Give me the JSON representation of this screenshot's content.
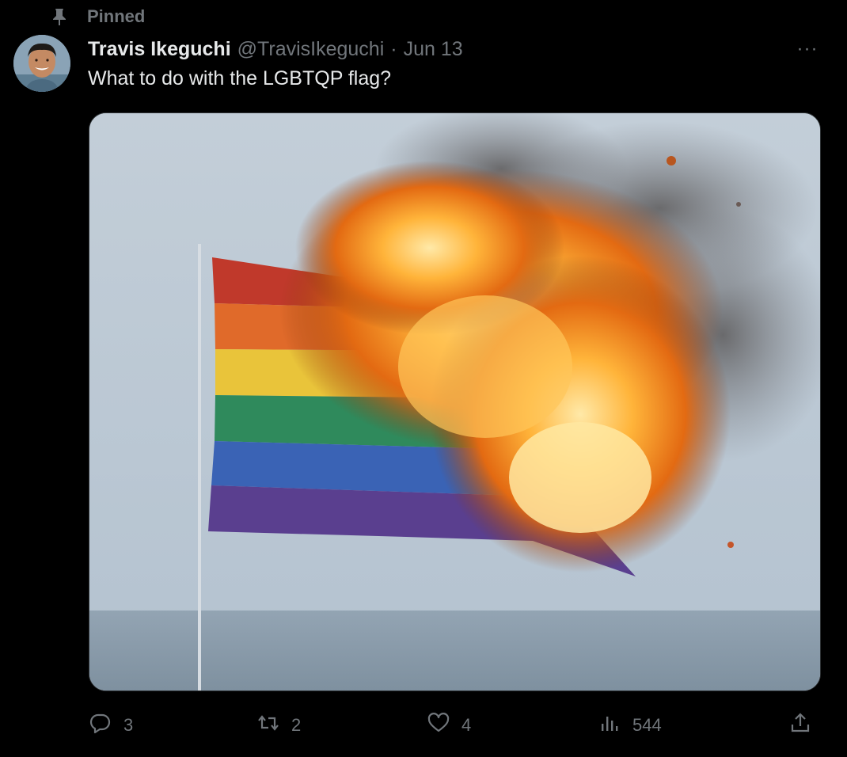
{
  "pinned": {
    "label": "Pinned",
    "icon": "pin-icon"
  },
  "tweet": {
    "display_name": "Travis Ikeguchi",
    "handle": "@TravisIkeguchi",
    "separator": "·",
    "date": "Jun 13",
    "text": "What to do with the LGBTQP flag?",
    "more_icon": "more-horizontal-icon",
    "more_label": "···",
    "media": {
      "description_icon": "photo-image"
    }
  },
  "actions": {
    "reply": {
      "icon": "reply-icon",
      "count": "3"
    },
    "retweet": {
      "icon": "retweet-icon",
      "count": "2"
    },
    "like": {
      "icon": "heart-icon",
      "count": "4"
    },
    "views": {
      "icon": "views-chart-icon",
      "count": "544"
    },
    "share": {
      "icon": "share-icon"
    }
  },
  "colors": {
    "background": "#000000",
    "text_primary": "#e7e9ea",
    "text_secondary": "#71767b",
    "border": "#2f3336"
  }
}
